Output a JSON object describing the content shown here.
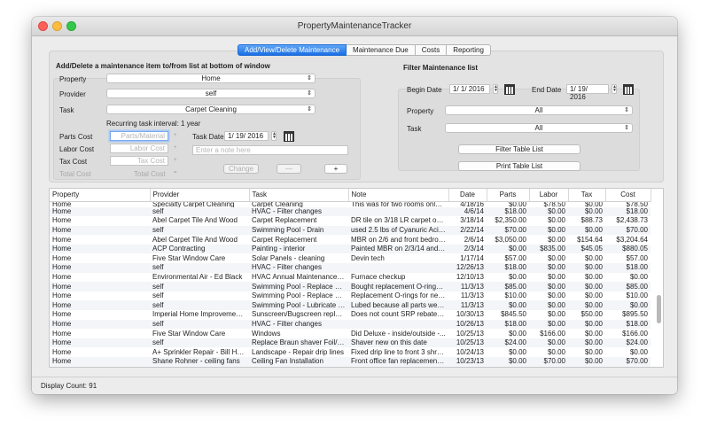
{
  "window": {
    "title": "PropertyMaintenanceTracker"
  },
  "tabs": [
    {
      "label": "Add/View/Delete Maintenance",
      "active": true
    },
    {
      "label": "Maintenance Due",
      "active": false
    },
    {
      "label": "Costs",
      "active": false
    },
    {
      "label": "Reporting",
      "active": false
    }
  ],
  "add_panel": {
    "heading": "Add/Delete a maintenance item to/from list at bottom of window",
    "property_label": "Property",
    "property_value": "Home",
    "provider_label": "Provider",
    "provider_value": "self",
    "task_label": "Task",
    "task_value": "Carpet Cleaning",
    "recurring_text": "Recurring task interval: 1 year",
    "parts_cost_label": "Parts Cost",
    "parts_cost_placeholder": "Parts/Material",
    "labor_cost_label": "Labor Cost",
    "labor_cost_placeholder": "Labor Cost",
    "tax_cost_label": "Tax Cost",
    "tax_cost_placeholder": "Tax Cost",
    "total_cost_label": "Total Cost",
    "total_cost_value": "Total Cost",
    "plus_sign": "+",
    "equals_sign": "=",
    "task_date_label": "Task Date",
    "task_date_value": "1/ 19/ 2016",
    "note_placeholder": "Enter a note here",
    "change_label": "Change",
    "minus_label": "—",
    "plus_label": "+"
  },
  "filter_panel": {
    "heading": "Filter Maintenance list",
    "begin_date_label": "Begin Date",
    "begin_date_value": "1/  1/ 2016",
    "end_date_label": "End Date",
    "end_date_value": "1/ 19/ 2016",
    "property_label": "Property",
    "property_value": "All",
    "task_label": "Task",
    "task_value": "All",
    "filter_button": "Filter Table List",
    "print_button": "Print Table List"
  },
  "table": {
    "columns": [
      "Property",
      "Provider",
      "Task",
      "Note",
      "Date",
      "Parts",
      "Labor",
      "Tax",
      "Cost"
    ],
    "partial_row": [
      "Home",
      "Specialty Carpet Cleaning",
      "Carpet Cleaning",
      "This was for two rooms only -...",
      "4/18/16",
      "$0.00",
      "$78.50",
      "$0.00",
      "$78.50"
    ],
    "rows": [
      [
        "Home",
        "self",
        "HVAC - Filter changes",
        "",
        "4/6/14",
        "$18.00",
        "$0.00",
        "$0.00",
        "$18.00"
      ],
      [
        "Home",
        "Abel Carpet Tile And Wood",
        "Carpet Replacement",
        "DR tile on 3/18 LR carpet on 3...",
        "3/18/14",
        "$2,350.00",
        "$0.00",
        "$88.73",
        "$2,438.73"
      ],
      [
        "Home",
        "self",
        "Swimming Pool - Drain",
        "used 2.5 lbs of Cyanuric Acid...",
        "2/22/14",
        "$70.00",
        "$0.00",
        "$0.00",
        "$70.00"
      ],
      [
        "Home",
        "Abel Carpet Tile And Wood",
        "Carpet Replacement",
        "MBR on 2/6 and front bedroo...",
        "2/6/14",
        "$3,050.00",
        "$0.00",
        "$154.64",
        "$3,204.64"
      ],
      [
        "Home",
        "ACP Contracting",
        "Painting - interior",
        "Painted MBR on 2/3/14 and of...",
        "2/3/14",
        "$0.00",
        "$835.00",
        "$45.05",
        "$880.05"
      ],
      [
        "Home",
        "Five Star Window Care",
        "Solar Panels - cleaning",
        "Devin tech",
        "1/17/14",
        "$57.00",
        "$0.00",
        "$0.00",
        "$57.00"
      ],
      [
        "Home",
        "self",
        "HVAC - Filter changes",
        "",
        "12/26/13",
        "$18.00",
        "$0.00",
        "$0.00",
        "$18.00"
      ],
      [
        "Home",
        "Environmental Air - Ed Black",
        "HVAC Annual Maintenance Ch...",
        "Furnace checkup",
        "12/10/13",
        "$0.00",
        "$0.00",
        "$0.00",
        "$0.00"
      ],
      [
        "Home",
        "self",
        "Swimming Pool - Replace Bac...",
        "Bought replacement O-rings f...",
        "11/3/13",
        "$85.00",
        "$0.00",
        "$0.00",
        "$85.00"
      ],
      [
        "Home",
        "self",
        "Swimming Pool - Replace Bac...",
        "Replacement O-rings for next...",
        "11/3/13",
        "$10.00",
        "$0.00",
        "$0.00",
        "$10.00"
      ],
      [
        "Home",
        "self",
        "Swimming Pool - Lubricate Ba...",
        "Lubed because all parts were...",
        "11/3/13",
        "$0.00",
        "$0.00",
        "$0.00",
        "$0.00"
      ],
      [
        "Home",
        "Imperial Home Improvement L...",
        "Sunscreen/Bugscreen replace...",
        "Does not count SRP rebate of...",
        "10/30/13",
        "$845.50",
        "$0.00",
        "$50.00",
        "$895.50"
      ],
      [
        "Home",
        "self",
        "HVAC - Filter changes",
        "",
        "10/26/13",
        "$18.00",
        "$0.00",
        "$0.00",
        "$18.00"
      ],
      [
        "Home",
        "Five Star Window Care",
        "Windows",
        "Did Deluxe - inside/outside -...",
        "10/25/13",
        "$0.00",
        "$166.00",
        "$0.00",
        "$166.00"
      ],
      [
        "Home",
        "self",
        "Replace Braun shaver Foil/Bla...",
        "Shaver new on this date",
        "10/25/13",
        "$24.00",
        "$0.00",
        "$0.00",
        "$24.00"
      ],
      [
        "Home",
        "A+ Sprinkler Repair - Bill Hub...",
        "Landscape - Repair drip lines",
        "Fixed drip line to front 3 shrubs",
        "10/24/13",
        "$0.00",
        "$0.00",
        "$0.00",
        "$0.00"
      ],
      [
        "Home",
        "Shane Rohner - ceiling fans",
        "Ceiling Fan Installation",
        "Front office fan replacement -...",
        "10/23/13",
        "$0.00",
        "$70.00",
        "$0.00",
        "$70.00"
      ]
    ]
  },
  "status": {
    "display_count": "Display Count: 91"
  }
}
